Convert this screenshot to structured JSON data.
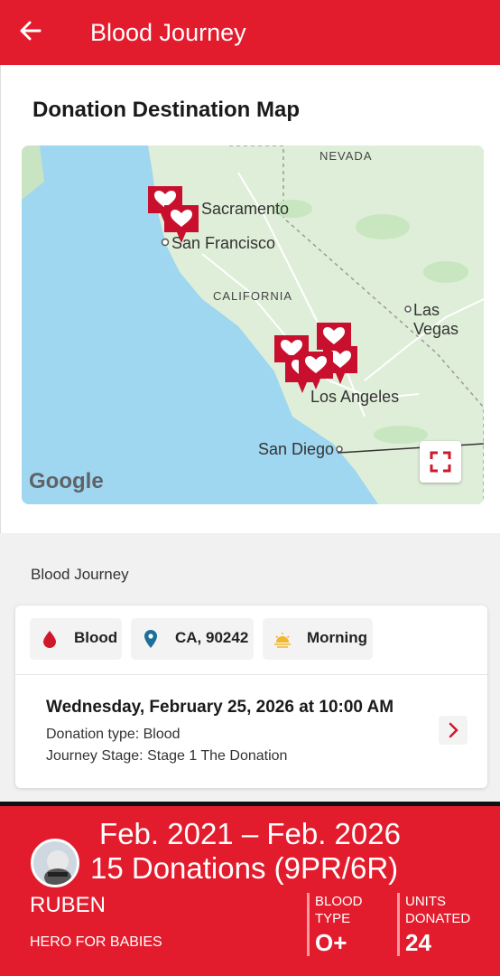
{
  "header": {
    "title": "Blood Journey"
  },
  "map": {
    "title": "Donation Destination Map",
    "labels": {
      "nevada": "NEVADA",
      "sacramento": "Sacramento",
      "san_francisco": "San Francisco",
      "california": "CALIFORNIA",
      "las_vegas": "Las Vegas",
      "los_angeles": "Los Angeles",
      "san_diego": "San Diego"
    },
    "attribution": "Google"
  },
  "journey": {
    "section_label": "Blood Journey",
    "chips": [
      {
        "icon": "blood-drop-icon",
        "label": "Blood"
      },
      {
        "icon": "location-pin-icon",
        "label": "CA, 90242"
      },
      {
        "icon": "sunrise-icon",
        "label": "Morning"
      }
    ],
    "event": {
      "datetime": "Wednesday, February 25, 2026 at 10:00 AM",
      "donation_type": "Donation type: Blood",
      "stage": "Journey Stage: Stage 1 The Donation"
    }
  },
  "footer": {
    "range": "Feb. 2021 – Feb. 2026",
    "donations": "15 Donations (9PR/6R)",
    "name": "RUBEN",
    "subtitle": "HERO FOR BABIES",
    "blood_type_label_1": "BLOOD",
    "blood_type_label_2": "TYPE",
    "blood_type": "O+",
    "units_label_1": "UNITS",
    "units_label_2": "DONATED",
    "units": "24"
  },
  "colors": {
    "brand_red": "#e31c2d",
    "pin_red": "#c8102e",
    "water": "#9fd6f0"
  }
}
